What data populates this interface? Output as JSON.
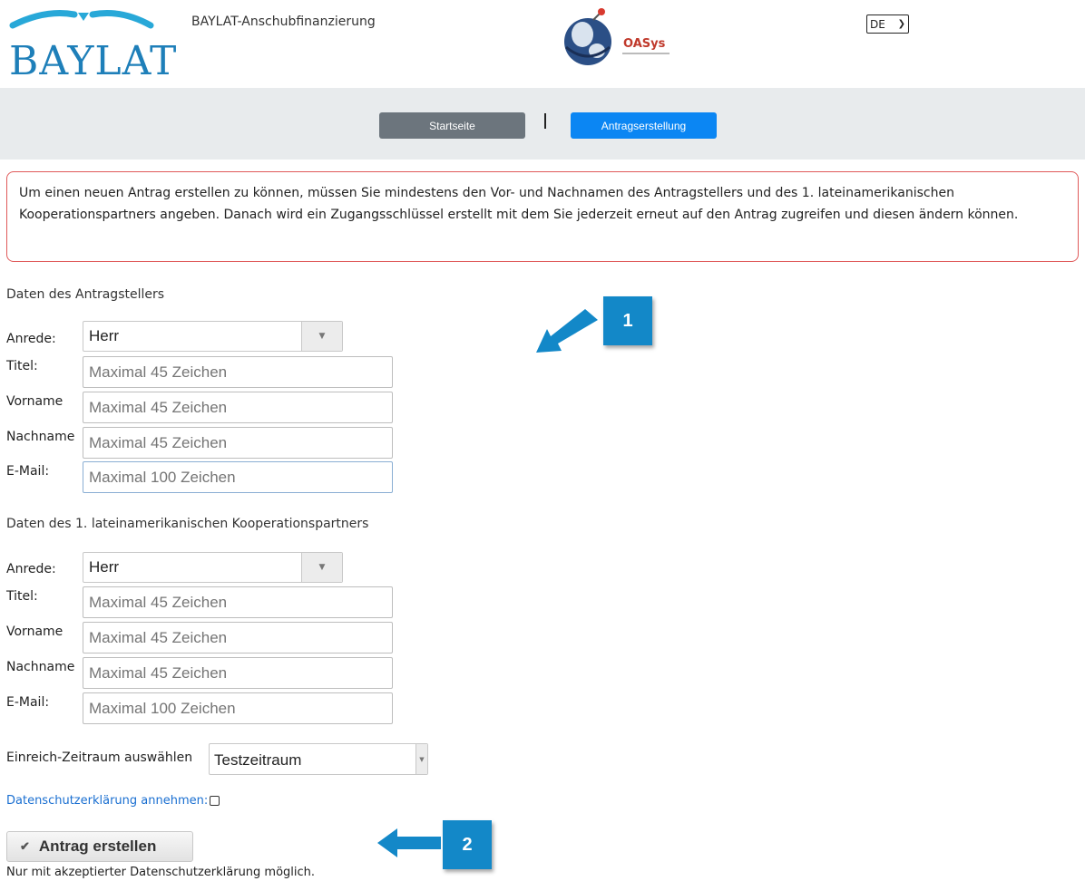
{
  "header": {
    "logo_text": "BAYLAT",
    "app_title": "BAYLAT-Anschubfinanzierung",
    "partner_logo_text": "OASys",
    "language": "DE"
  },
  "nav": {
    "home_label": "Startseite",
    "separator": "I",
    "create_label": "Antragserstellung"
  },
  "info_text": "Um einen neuen Antrag erstellen zu können, müssen Sie mindestens den Vor- und Nachnamen des Antragstellers und des 1. lateinamerikanischen Kooperationspartners angeben. Danach wird ein Zugangsschlüssel erstellt mit dem Sie jederzeit erneut auf den Antrag zugreifen und diesen ändern können.",
  "applicant": {
    "heading": "Daten des Antragstellers",
    "salutation_label": "Anrede:",
    "salutation_value": "Herr",
    "title_label": "Titel:",
    "title_placeholder": "Maximal 45 Zeichen",
    "firstname_label": "Vorname",
    "firstname_placeholder": "Maximal 45 Zeichen",
    "lastname_label": "Nachname",
    "lastname_placeholder": "Maximal 45 Zeichen",
    "email_label": "E-Mail:",
    "email_placeholder": "Maximal 100 Zeichen"
  },
  "partner": {
    "heading": "Daten des 1. lateinamerikanischen Kooperationspartners",
    "salutation_label": "Anrede:",
    "salutation_value": "Herr",
    "title_label": "Titel:",
    "title_placeholder": "Maximal 45 Zeichen",
    "firstname_label": "Vorname",
    "firstname_placeholder": "Maximal 45 Zeichen",
    "lastname_label": "Nachname",
    "lastname_placeholder": "Maximal 45 Zeichen",
    "email_label": "E-Mail:",
    "email_placeholder": "Maximal 100 Zeichen"
  },
  "period": {
    "label": "Einreich-Zeitraum auswählen",
    "value": "Testzeitraum"
  },
  "privacy": {
    "label": "Datenschutzerklärung annehmen:"
  },
  "submit": {
    "label": "Antrag erstellen",
    "note": "Nur mit akzeptierter Datenschutzerklärung möglich."
  },
  "annotations": {
    "callout_1": "1",
    "callout_2": "2",
    "color": "#1388c8"
  },
  "colors": {
    "brand_blue": "#1e7fb9",
    "nav_active": "#0b86f3",
    "nav_inactive": "#6c757d",
    "alert_border": "#e05a5a",
    "link": "#1a6fd1"
  }
}
